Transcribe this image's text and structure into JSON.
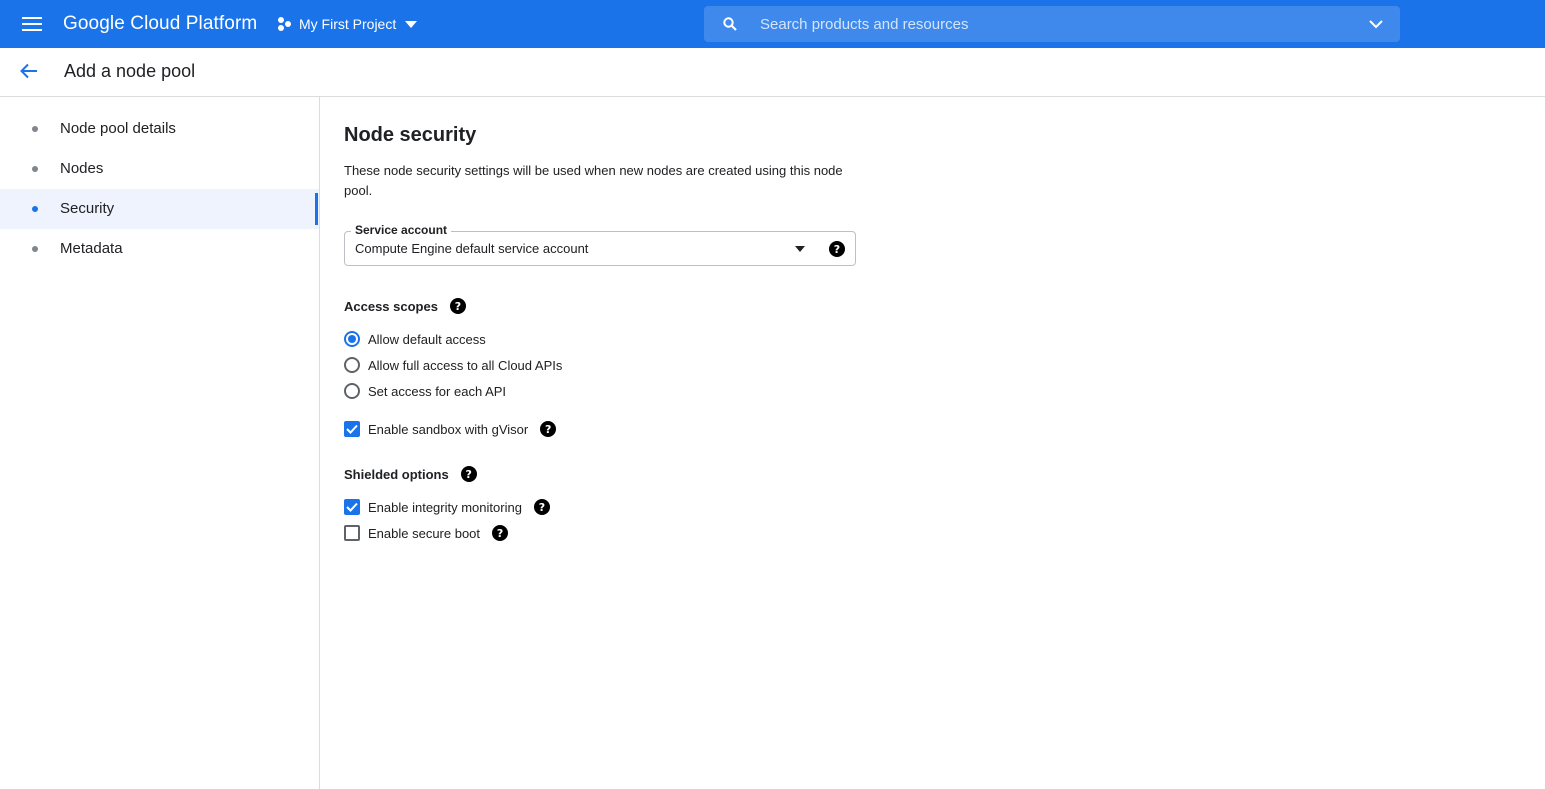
{
  "topbar": {
    "product_name": "Google Cloud Platform",
    "project_name": "My First Project",
    "search_placeholder": "Search products and resources",
    "color": "#1a73e8"
  },
  "header": {
    "title": "Add a node pool"
  },
  "stepper": {
    "items": [
      {
        "label": "Node pool details",
        "active": false
      },
      {
        "label": "Nodes",
        "active": false
      },
      {
        "label": "Security",
        "active": true
      },
      {
        "label": "Metadata",
        "active": false
      }
    ]
  },
  "main": {
    "section_title": "Node security",
    "description": "These node security settings will be used when new nodes are created using this node pool.",
    "service_account": {
      "label": "Service account",
      "value": "Compute Engine default service account"
    },
    "access_scopes": {
      "label": "Access scopes",
      "options": [
        {
          "label": "Allow default access",
          "selected": true
        },
        {
          "label": "Allow full access to all Cloud APIs",
          "selected": false
        },
        {
          "label": "Set access for each API",
          "selected": false
        }
      ]
    },
    "sandbox": {
      "label": "Enable sandbox with gVisor",
      "checked": true
    },
    "shielded": {
      "label": "Shielded options",
      "integrity": {
        "label": "Enable integrity monitoring",
        "checked": true
      },
      "secure_boot": {
        "label": "Enable secure boot",
        "checked": false
      }
    }
  },
  "icons": {
    "menu": "menu-icon",
    "project": "project-icon",
    "search": "search-icon",
    "back": "arrow-back-icon",
    "help": "help-icon"
  }
}
